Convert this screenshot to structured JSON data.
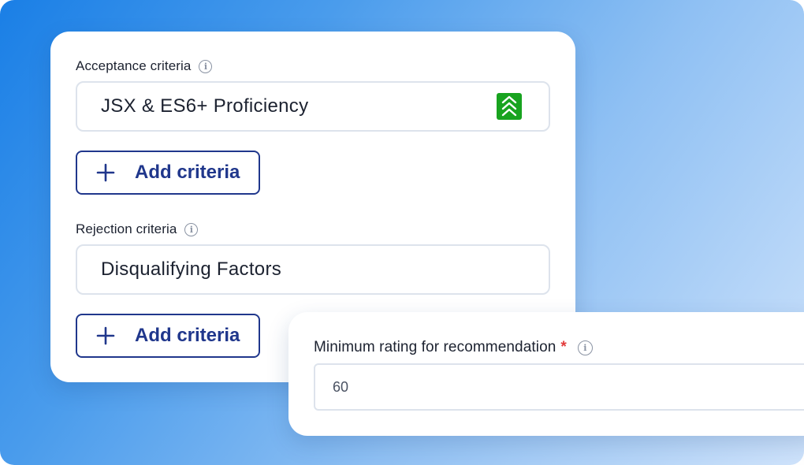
{
  "colors": {
    "accent": "#20378c",
    "priority_badge": "#18a31f",
    "required_star": "#e23b3b"
  },
  "acceptance": {
    "label": "Acceptance criteria",
    "criterion_value": "JSX & ES6+ Proficiency",
    "priority_icon": "double-chevron-up-icon",
    "add_button_label": "Add criteria"
  },
  "rejection": {
    "label": "Rejection criteria",
    "criterion_value": "Disqualifying Factors",
    "add_button_label": "Add criteria"
  },
  "rating": {
    "label": "Minimum rating for recommendation",
    "required_marker": "*",
    "value": "60"
  }
}
